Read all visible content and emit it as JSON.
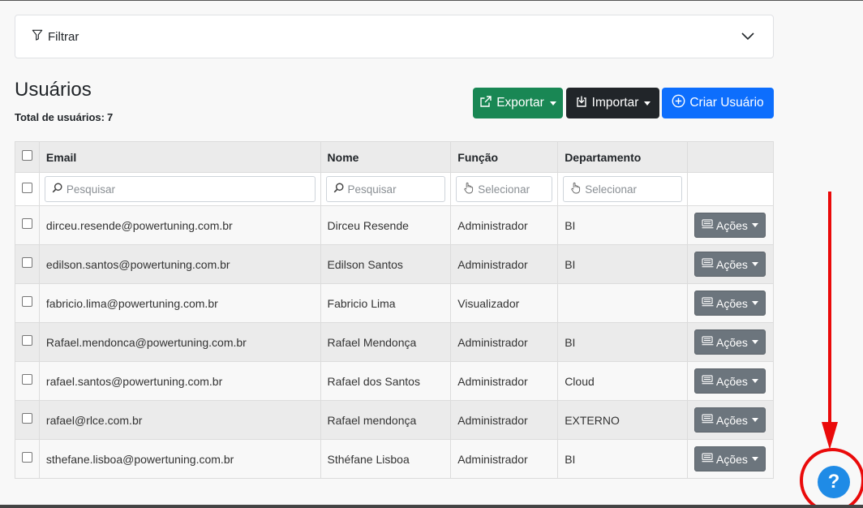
{
  "filter": {
    "label": "Filtrar"
  },
  "header": {
    "title": "Usuários",
    "total_label": "Total de usuários:",
    "total_count": "7"
  },
  "toolbar": {
    "export_label": "Exportar",
    "import_label": "Importar",
    "create_label": "Criar Usuário"
  },
  "table": {
    "columns": [
      "Email",
      "Nome",
      "Função",
      "Departamento"
    ],
    "filters": {
      "email_placeholder": "Pesquisar",
      "name_placeholder": "Pesquisar",
      "func_placeholder": "Selecionar",
      "dept_placeholder": "Selecionar"
    },
    "actions_label": "Ações",
    "rows": [
      {
        "email": "dirceu.resende@powertuning.com.br",
        "name": "Dirceu Resende",
        "func": "Administrador",
        "dept": "BI"
      },
      {
        "email": "edilson.santos@powertuning.com.br",
        "name": "Edilson Santos",
        "func": "Administrador",
        "dept": "BI"
      },
      {
        "email": "fabricio.lima@powertuning.com.br",
        "name": "Fabricio Lima",
        "func": "Visualizador",
        "dept": ""
      },
      {
        "email": "Rafael.mendonca@powertuning.com.br",
        "name": "Rafael Mendonça",
        "func": "Administrador",
        "dept": "BI"
      },
      {
        "email": "rafael.santos@powertuning.com.br",
        "name": "Rafael dos Santos",
        "func": "Administrador",
        "dept": "Cloud"
      },
      {
        "email": "rafael@rlce.com.br",
        "name": "Rafael mendonça",
        "func": "Administrador",
        "dept": "EXTERNO"
      },
      {
        "email": "sthefane.lisboa@powertuning.com.br",
        "name": "Sthéfane Lisboa",
        "func": "Administrador",
        "dept": "BI"
      }
    ]
  },
  "help": {
    "label": "?"
  },
  "colors": {
    "export": "#198754",
    "import": "#212529",
    "create": "#0d6efd",
    "actions": "#6c757d",
    "help": "#1f8be6",
    "annotation": "#ea0a0a"
  }
}
